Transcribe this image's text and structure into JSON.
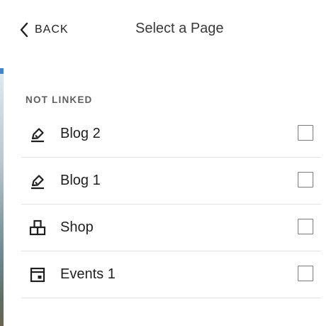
{
  "header": {
    "back_label": "BACK",
    "title": "Select a Page"
  },
  "section": {
    "label": "NOT LINKED"
  },
  "items": [
    {
      "label": "Blog 2",
      "icon": "blog-icon",
      "checked": false
    },
    {
      "label": "Blog 1",
      "icon": "blog-icon",
      "checked": false
    },
    {
      "label": "Shop",
      "icon": "shop-icon",
      "checked": false
    },
    {
      "label": "Events 1",
      "icon": "events-icon",
      "checked": false
    }
  ],
  "colors": {
    "text": "#1f1f1f",
    "muted": "#5e5e5e",
    "divider": "#e3e3e3"
  }
}
